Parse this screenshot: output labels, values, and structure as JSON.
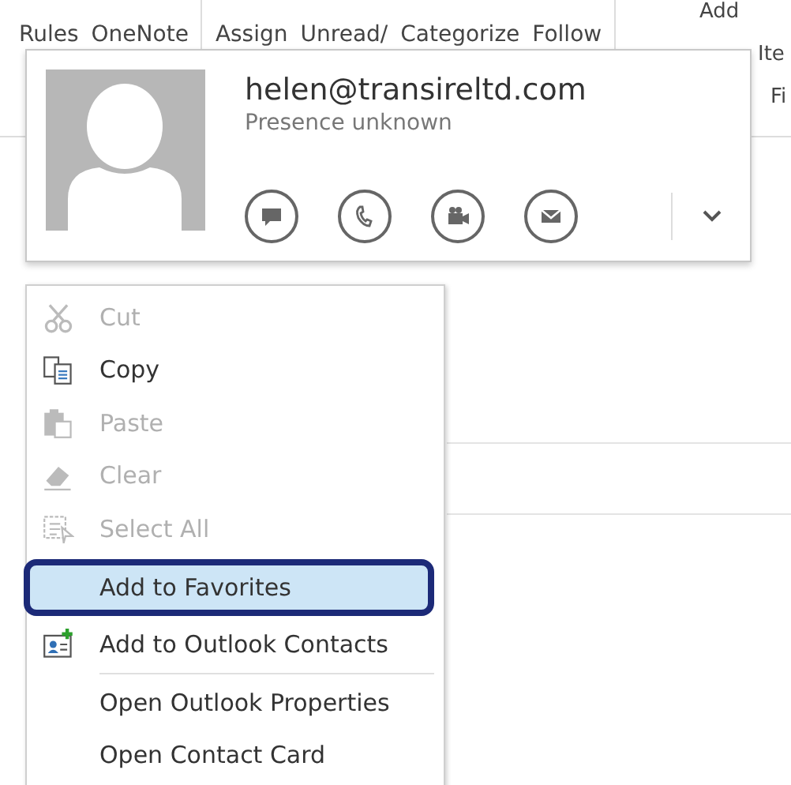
{
  "ribbon": {
    "groups": [
      [
        "Rules",
        "OneNote"
      ],
      [
        "Assign",
        "Unread/",
        "Categorize",
        "Follow"
      ]
    ],
    "right_items": [
      "Add",
      "Ite",
      "Fi"
    ]
  },
  "contact_card": {
    "email": "helen@transireltd.com",
    "presence": "Presence unknown"
  },
  "context_menu": {
    "items": [
      {
        "label": "Cut",
        "kind": "cut",
        "disabled": true,
        "selected": false
      },
      {
        "label": "Copy",
        "kind": "copy",
        "disabled": false,
        "selected": false
      },
      {
        "label": "Paste",
        "kind": "paste",
        "disabled": true,
        "selected": false
      },
      {
        "label": "Clear",
        "kind": "clear",
        "disabled": true,
        "selected": false
      },
      {
        "label": "Select All",
        "kind": "select-all",
        "disabled": true,
        "selected": false
      },
      {
        "label": "Add to Favorites",
        "kind": "plain",
        "disabled": false,
        "selected": true
      },
      {
        "label": "Add to Outlook Contacts",
        "kind": "add-contact",
        "disabled": false,
        "selected": false
      },
      {
        "kind": "separator"
      },
      {
        "label": "Open Outlook Properties",
        "kind": "plain",
        "disabled": false,
        "selected": false
      },
      {
        "label": "Open Contact Card",
        "kind": "plain",
        "disabled": false,
        "selected": false
      }
    ]
  }
}
